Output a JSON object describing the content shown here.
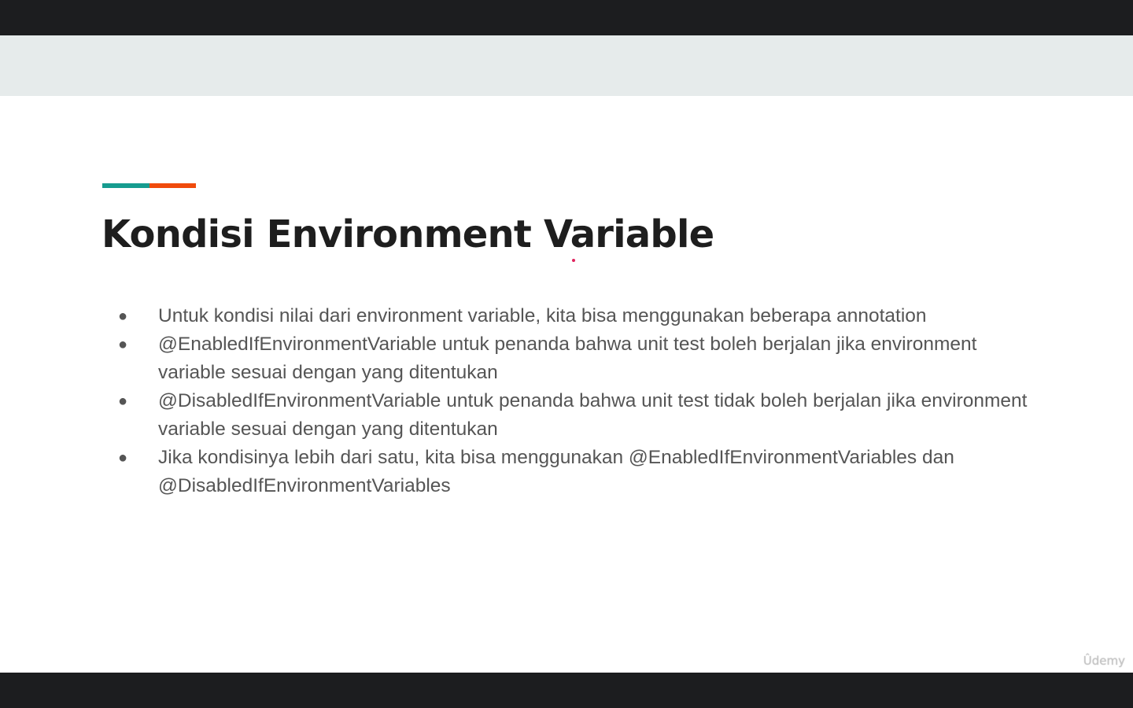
{
  "slide": {
    "title": "Kondisi Environment Variable",
    "bullet_symbol": "●",
    "bullets": [
      "Untuk kondisi nilai dari environment variable, kita bisa menggunakan beberapa annotation",
      "@EnabledIfEnvironmentVariable untuk penanda bahwa unit test boleh berjalan jika environment variable sesuai dengan yang ditentukan",
      "@DisabledIfEnvironmentVariable untuk penanda bahwa unit test tidak boleh berjalan jika environment variable sesuai dengan yang ditentukan",
      "Jika kondisinya lebih dari satu, kita bisa menggunakan @EnabledIfEnvironmentVariables dan @DisabledIfEnvironmentVariables"
    ],
    "accent_colors": [
      "#169c8f",
      "#f04b0c"
    ]
  },
  "watermark": "Ûdemy",
  "colors": {
    "player_background": "#1c1d1f",
    "header_band": "#e6ebeb",
    "title_text": "#1e1e1e",
    "body_text": "#555555",
    "pointer": "#e0245e"
  }
}
